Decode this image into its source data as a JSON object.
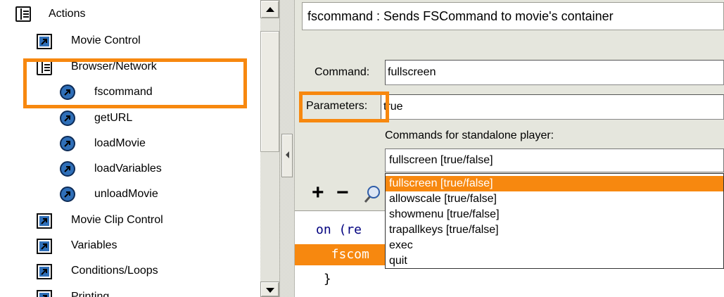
{
  "actions_panel": {
    "items": [
      {
        "label": "Actions",
        "icon": "book-icon"
      },
      {
        "label": "Movie Control",
        "icon": "action-arrow-icon"
      },
      {
        "label": "Browser/Network",
        "icon": "book-icon"
      },
      {
        "label": "fscommand",
        "icon": "action-circle-icon"
      },
      {
        "label": "getURL",
        "icon": "action-circle-icon"
      },
      {
        "label": "loadMovie",
        "icon": "action-circle-icon"
      },
      {
        "label": "loadVariables",
        "icon": "action-circle-icon"
      },
      {
        "label": "unloadMovie",
        "icon": "action-circle-icon"
      },
      {
        "label": "Movie Clip Control",
        "icon": "action-arrow-icon"
      },
      {
        "label": "Variables",
        "icon": "action-arrow-icon"
      },
      {
        "label": "Conditions/Loops",
        "icon": "action-arrow-icon"
      },
      {
        "label": "Printing",
        "icon": "action-arrow-icon"
      }
    ]
  },
  "parameters_panel": {
    "description": "fscommand : Sends FSCommand to movie's container",
    "command_label": "Command:",
    "command_value": "fullscreen",
    "parameters_label": "Parameters:",
    "parameters_value": "true",
    "standalone_label": "Commands for standalone player:",
    "standalone_selected": "fullscreen [true/false]",
    "standalone_options": [
      "fullscreen [true/false]",
      "allowscale [true/false]",
      "showmenu [true/false]",
      "trapallkeys [true/false]",
      "exec",
      "quit"
    ]
  },
  "toolbar": {
    "add_label": "+",
    "remove_label": "−"
  },
  "script": {
    "lines": [
      "on (re",
      "  fscom",
      " }"
    ]
  },
  "colors": {
    "highlight": "#f7880f",
    "icon_blue": "#2f6fb8"
  }
}
